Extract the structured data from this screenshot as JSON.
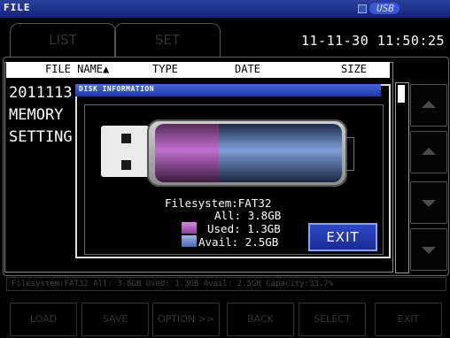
{
  "titlebar": {
    "title": "FILE",
    "media_label": "USB"
  },
  "tabs": [
    {
      "label": "LIST"
    },
    {
      "label": "SET"
    }
  ],
  "clock": "11-11-30 11:50:25",
  "list_header": {
    "file_name": "FILE NAME▲",
    "type": "TYPE",
    "date": "DATE",
    "size": "SIZE"
  },
  "files": [
    {
      "name": "2011113("
    },
    {
      "name": "MEMORY"
    },
    {
      "name": "SETTING"
    }
  ],
  "status_line": "Filesystem:FAT32 All: 3.8GB Used: 1.3GB Avail: 2.5GB Capacity:33.7%",
  "footer_buttons": [
    {
      "label": "LOAD"
    },
    {
      "label": "SAVE"
    },
    {
      "label": "OPTION >>"
    },
    {
      "label": "BACK"
    },
    {
      "label": "SELECT"
    },
    {
      "label": "EXIT"
    }
  ],
  "dialog": {
    "title": "DISK INFORMATION",
    "filesystem": "Filesystem:FAT32",
    "all": "All: 3.8GB",
    "used": "Used: 1.3GB",
    "avail": "Avail: 2.5GB",
    "exit_label": "EXIT",
    "used_fraction": 0.34
  },
  "colors": {
    "used": "#b45fc4",
    "avail": "#6f8fd0",
    "titlebar": "#1e2f8a"
  },
  "icons": {
    "usb": "usb-drive-icon",
    "up": "arrow-up-icon",
    "down": "arrow-down-icon"
  }
}
